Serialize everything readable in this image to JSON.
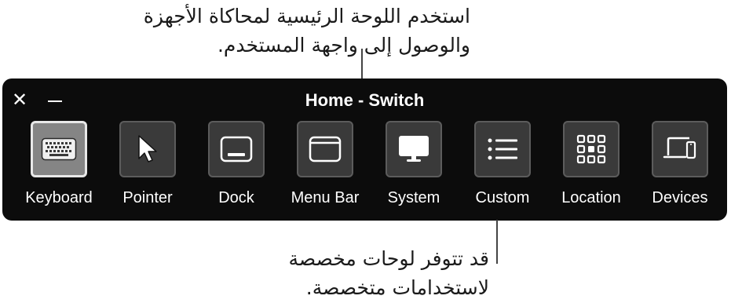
{
  "callouts": {
    "top": [
      "استخدم اللوحة الرئيسية لمحاكاة الأجهزة",
      "والوصول إلى واجهة المستخدم."
    ],
    "bottom": [
      "قد تتوفر لوحات مخصصة",
      "لاستخدامات متخصصة."
    ]
  },
  "panel": {
    "title": "Home - Switch",
    "close_label": "✕",
    "selected_tool": "Keyboard",
    "tools": [
      {
        "label": "Keyboard",
        "icon": "keyboard-icon"
      },
      {
        "label": "Pointer",
        "icon": "pointer-arrow-icon"
      },
      {
        "label": "Dock",
        "icon": "dock-icon"
      },
      {
        "label": "Menu Bar",
        "icon": "menu-bar-icon"
      },
      {
        "label": "System",
        "icon": "display-icon"
      },
      {
        "label": "Custom",
        "icon": "list-icon"
      },
      {
        "label": "Location",
        "icon": "grid-icon"
      },
      {
        "label": "Devices",
        "icon": "devices-icon"
      }
    ]
  },
  "colors": {
    "panel_background": "#0c0c0c",
    "tile_background": "#3a3a3a",
    "selected_tile_background": "#858585",
    "text": "#ffffff"
  }
}
